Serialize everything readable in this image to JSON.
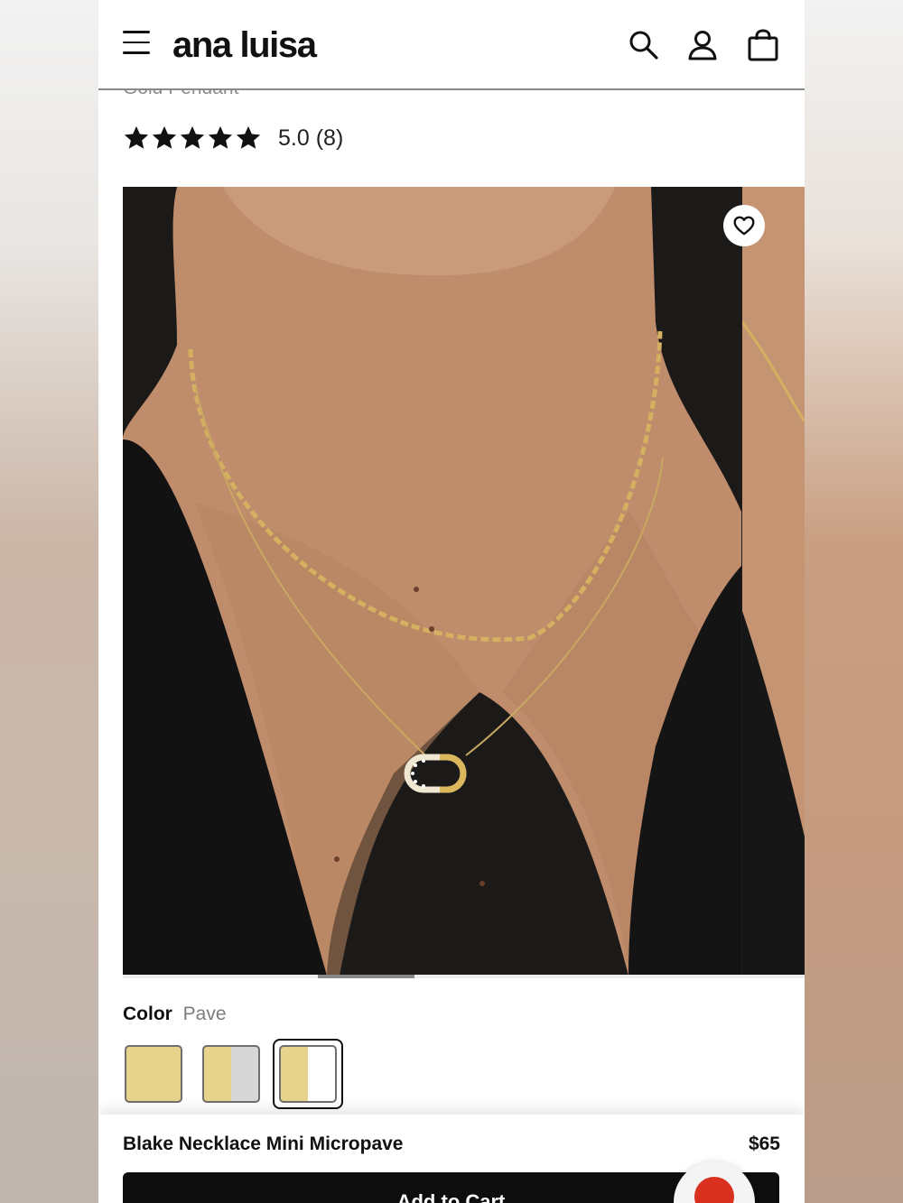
{
  "header": {
    "brand": "ana luisa",
    "menu_icon": "menu-icon",
    "search_icon": "search-icon",
    "account_icon": "account-icon",
    "bag_icon": "bag-icon"
  },
  "product": {
    "subtitle": "Gold Pendant",
    "rating": {
      "stars": 5,
      "score_text": "5.0",
      "count_text": "(8)"
    },
    "name": "Blake Necklace Mini Micropave",
    "price": "$65"
  },
  "gallery": {
    "wishlist_icon": "heart-icon",
    "scroll_position": 0.29
  },
  "color": {
    "label": "Color",
    "selected": "Pave",
    "swatches": [
      {
        "colors": [
          "#e7d38b"
        ],
        "selected": false
      },
      {
        "colors": [
          "#e7d38b",
          "#d7d7d7"
        ],
        "selected": false
      },
      {
        "colors": [
          "#e7d38b",
          "#ffffff"
        ],
        "selected": true
      }
    ]
  },
  "cta": {
    "label": "Add to Cart"
  },
  "chat": {
    "icon": "chat-icon",
    "color": "#d9301f"
  }
}
